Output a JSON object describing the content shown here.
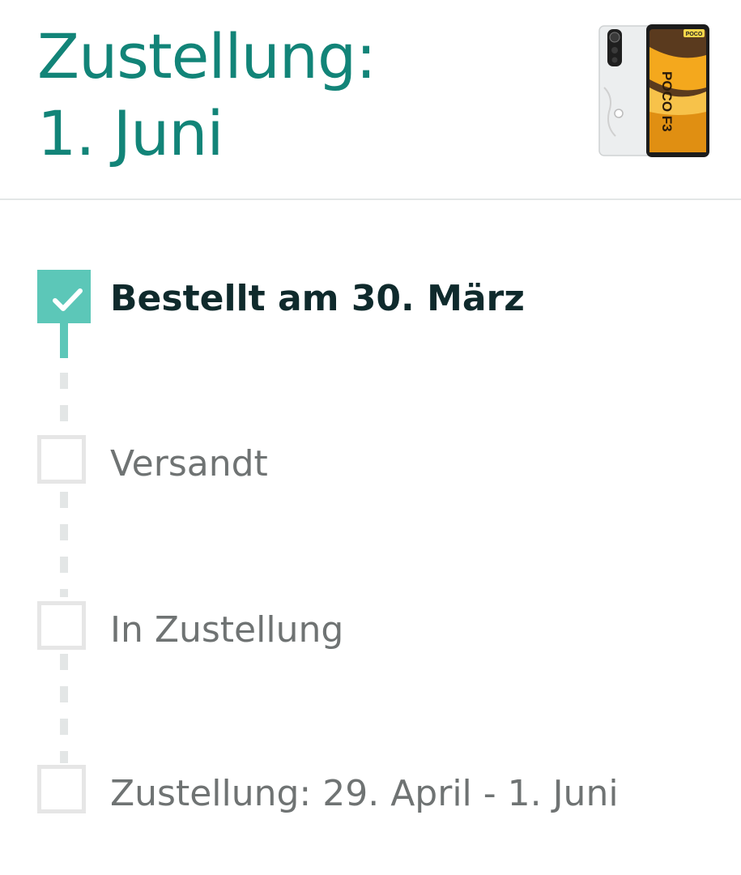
{
  "delivery": {
    "title_line1": "Zustellung:",
    "title_line2": "1. Juni"
  },
  "product": {
    "image": "phone-image",
    "brand_text": "POCO F3"
  },
  "steps": [
    {
      "label": "Bestellt am 30. März",
      "status": "done"
    },
    {
      "label": "Versandt",
      "status": "pending"
    },
    {
      "label": "In Zustellung",
      "status": "pending"
    },
    {
      "label": "Zustellung: 29. April - 1. Juni",
      "status": "pending"
    }
  ],
  "colors": {
    "title": "#128478",
    "accent": "#5cc7b8",
    "pending": "#e6e6e6",
    "done_text": "#0f2a2c",
    "pending_text": "#6f7373"
  }
}
